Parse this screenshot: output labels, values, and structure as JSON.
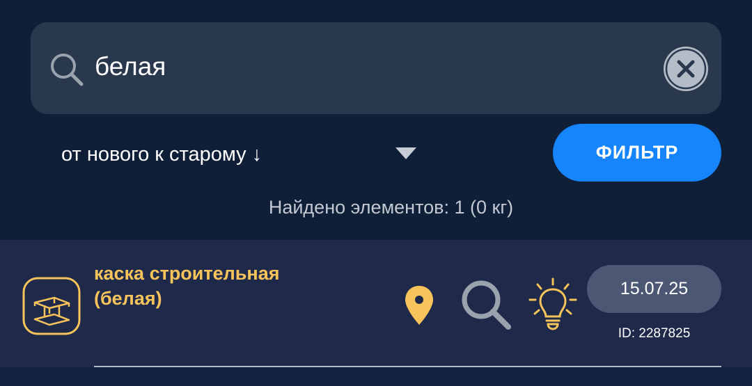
{
  "search": {
    "value": "белая",
    "icon": "search-icon",
    "clear_icon": "close-icon"
  },
  "sort": {
    "label": "от нового к старому ↓",
    "icon": "triangle-down-icon"
  },
  "filter": {
    "label": "ФИЛЬТР"
  },
  "results": {
    "summary": "Найдено элементов: 1 (0 кг)"
  },
  "items": [
    {
      "title": "каска строительная (белая)",
      "category_icon": "steel-beam-icon",
      "date": "15.07.25",
      "id": "ID: 2287825"
    }
  ],
  "colors": {
    "background": "#0f1f38",
    "search_bg": "#29384d",
    "accent_blue": "#1684fb",
    "item_bg": "#1f2a4b",
    "title_yellow": "#f7c35b",
    "badge_bg": "#4c5873"
  }
}
